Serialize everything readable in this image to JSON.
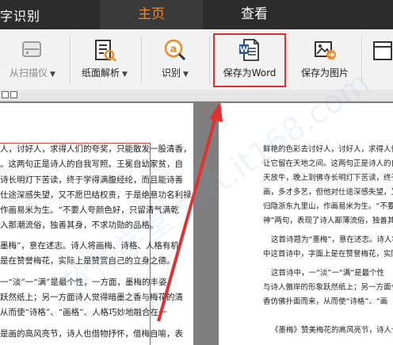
{
  "titlebar": {
    "app_title": "字识别",
    "tabs": [
      {
        "label": "主页",
        "active": true
      },
      {
        "label": "查看",
        "active": false
      }
    ]
  },
  "ribbon": {
    "buttons": [
      {
        "label": "从扫描仪",
        "icon": "scanner-icon",
        "has_dropdown": true,
        "disabled": true
      },
      {
        "label": "纸面解析",
        "icon": "document-analysis-icon",
        "has_dropdown": true
      },
      {
        "label": "识别",
        "icon": "ocr-recognize-icon",
        "has_dropdown": true
      },
      {
        "label": "保存为Word",
        "icon": "word-file-icon",
        "has_dropdown": false,
        "highlighted": true
      },
      {
        "label": "保存为图片",
        "icon": "save-image-icon",
        "has_dropdown": false
      },
      {
        "label": "",
        "icon": "more-icon"
      }
    ]
  },
  "left_page": {
    "lines": [
      "人，讨好人，求得人们的夸奖，只能散发一股清香，",
      "。这两句正是诗人的自我写照。王冕自幼家贫，自",
      "诗长明灯下苦读，终于学得满腹经纶，而且能诗善",
      "仕途深感失望，又不愿巴结权贵，于是绝意功名利禄，",
      "作画易米为生。“不要人夸颜色好，只留清气满乾",
      "入那潮流俗，独善其身，不求功勋的品格。",
      "墨梅”，意在述志。诗人将画梅、诗格、人格有机",
      "是在赞誉梅花，实际上是赞赏自己的立身之德。",
      "一“淡”一“满”是最个性，一方面，墨梅的丰姿",
      "跃然纸上；另一方面诗人觉得暗墨之香与梅花的清",
      "从而使“诗格”、“画格”、人格巧妙地融合在一",
      "是画的高风亮节，诗人也借物抒怀，借梅自喻，表"
    ]
  },
  "right_page": {
    "lines": [
      "鲜艳的色彩去讨好人，讨好人，求得人们的夸",
      "让它留在天地之间。这两句正是诗人的自我写",
      "天放牛，晚上到佛寺长明灯下苦读，终于学得",
      "画，多才多艺，但他对仕途深感失望，又不愿巴结",
      "归隐浙东九里山，作画易米为生。“不要人夸",
      "神”两句，表现了诗人鄙薄流俗，独善其身",
      "这首诗题为“墨梅”，意在述志。诗人将",
      "中这首诗中，字面上是在赞誉梅花，实际上是赞",
      "这首诗中，一“淡”一“满”是最个性",
      "与诗人傲岸的形象跃然纸上；另一方面令人",
      "香仿佛扑面而来，从而使“诗格”、“画",
      "《墨梅》赞美梅花的高风亮节，诗人也借"
    ]
  },
  "watermark": "软件学堂 soft.it168.com"
}
